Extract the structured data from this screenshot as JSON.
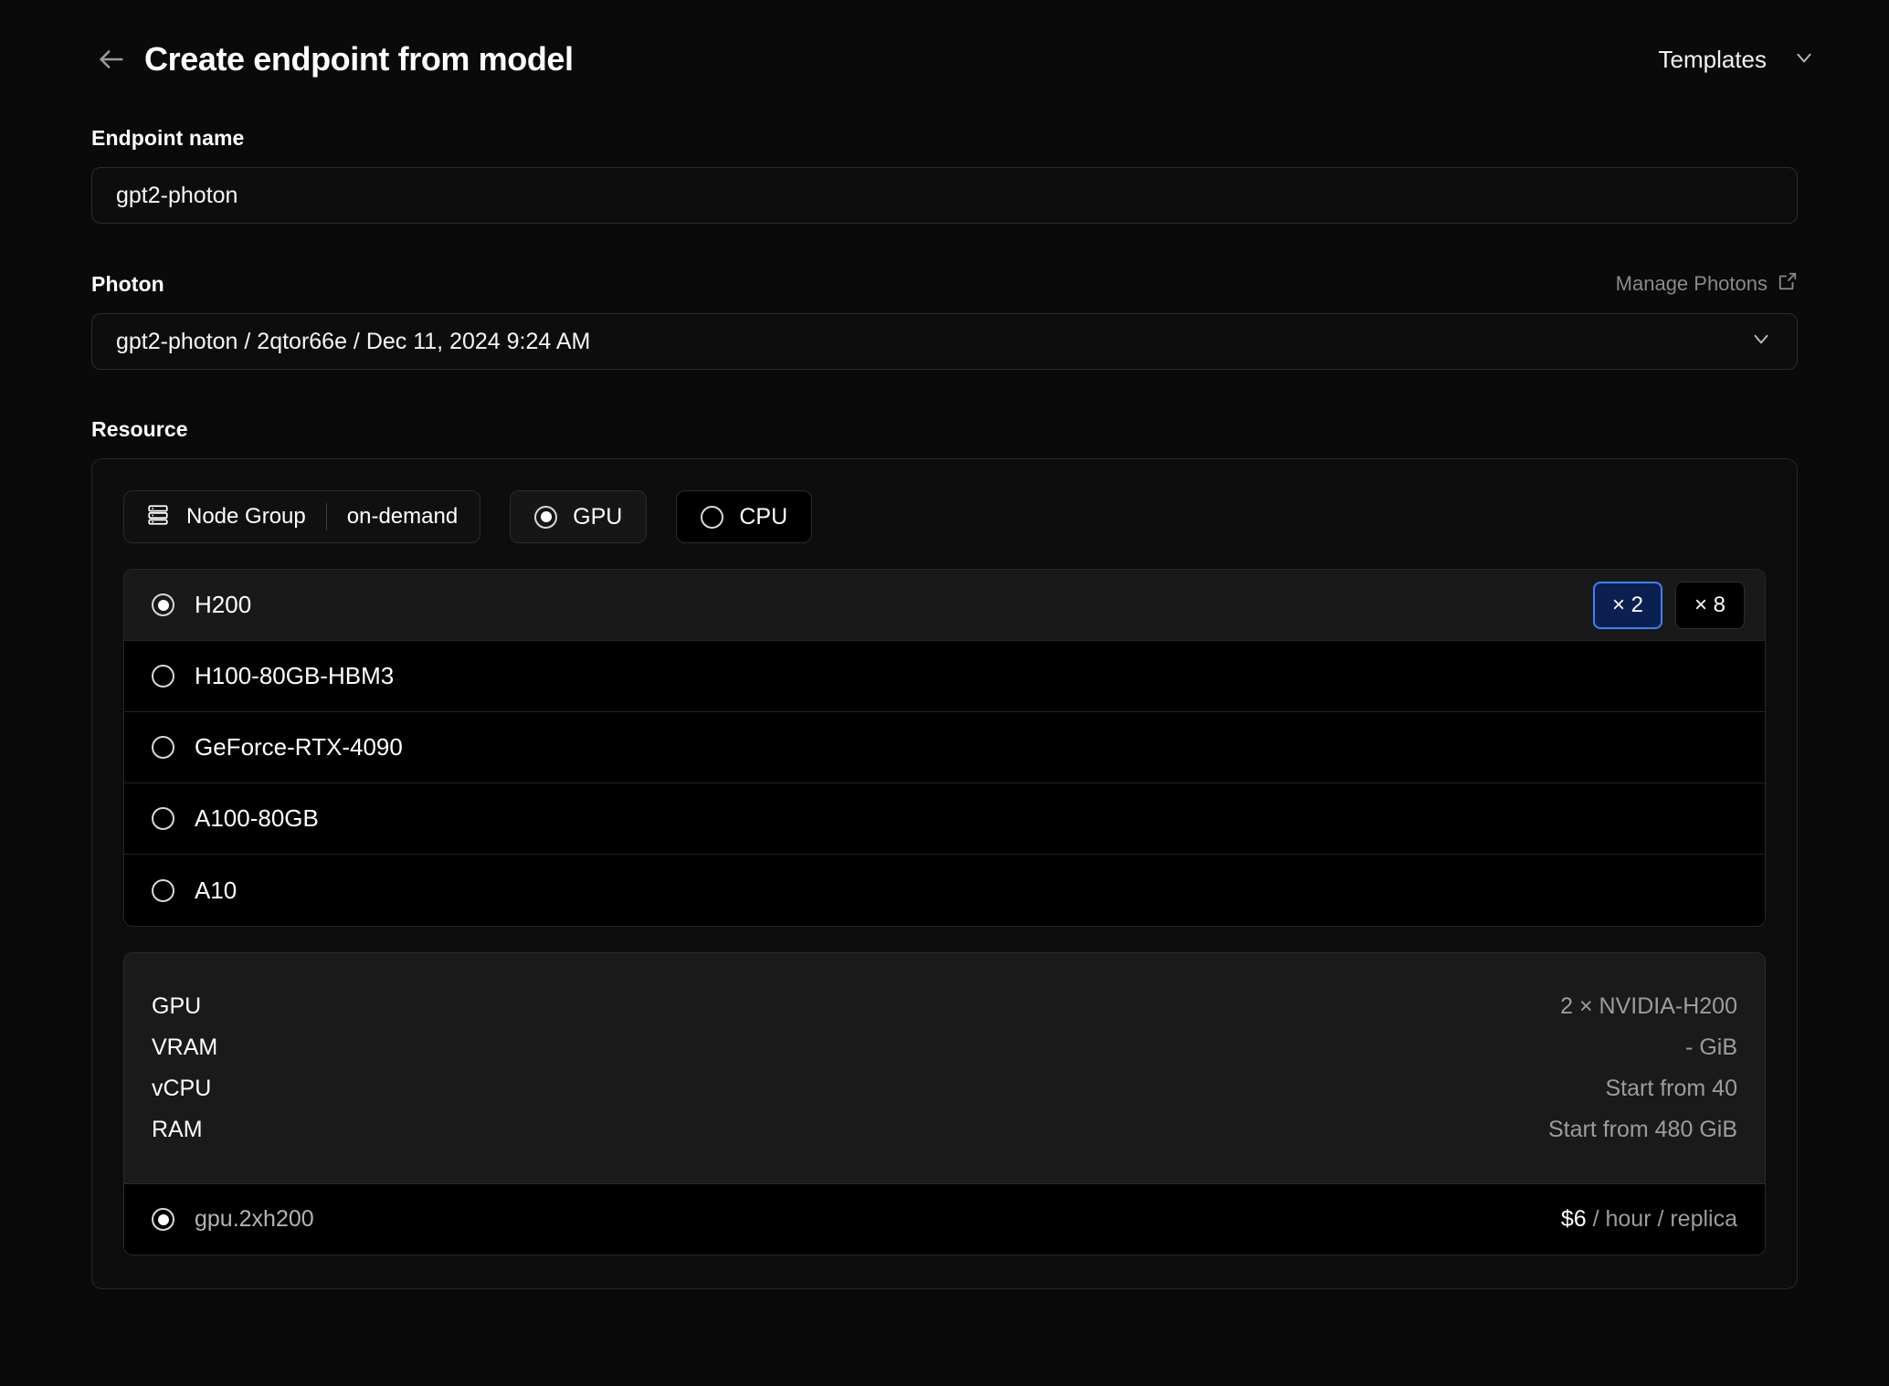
{
  "header": {
    "back_icon": "arrow-left-icon",
    "title": "Create endpoint from model",
    "templates_label": "Templates",
    "templates_chevron": "chevron-down-icon"
  },
  "endpoint_name": {
    "label": "Endpoint name",
    "value": "gpt2-photon",
    "placeholder": "Endpoint name"
  },
  "photon": {
    "label": "Photon",
    "manage_label": "Manage Photons",
    "manage_icon": "external-link-icon",
    "selected": "gpt2-photon / 2qtor66e / Dec 11, 2024 9:24 AM",
    "chevron": "chevron-down-icon"
  },
  "resource": {
    "label": "Resource",
    "node_group": {
      "icon": "server-stack-icon",
      "label": "Node Group",
      "value": "on-demand"
    },
    "compute_types": [
      {
        "label": "GPU",
        "selected": true
      },
      {
        "label": "CPU",
        "selected": false
      }
    ],
    "gpu_options": [
      {
        "label": "H200",
        "selected": true,
        "counts": [
          {
            "label": "× 2",
            "active": true
          },
          {
            "label": "× 8",
            "active": false
          }
        ]
      },
      {
        "label": "H100-80GB-HBM3",
        "selected": false,
        "counts": []
      },
      {
        "label": "GeForce-RTX-4090",
        "selected": false,
        "counts": []
      },
      {
        "label": "A100-80GB",
        "selected": false,
        "counts": []
      },
      {
        "label": "A10",
        "selected": false,
        "counts": []
      }
    ],
    "spec": [
      {
        "key": "GPU",
        "value": "2 × NVIDIA-H200"
      },
      {
        "key": "VRAM",
        "value": "- GiB"
      },
      {
        "key": "vCPU",
        "value": "Start from 40"
      },
      {
        "key": "RAM",
        "value": "Start from 480 GiB"
      }
    ],
    "plan": {
      "name": "gpu.2xh200",
      "selected": true,
      "price_amount": "$6",
      "price_unit": " / hour / replica"
    }
  },
  "colors": {
    "accent_blue": "#3b82f6",
    "accent_blue_fill": "#0b2050",
    "page_bg": "#0a0a0a",
    "muted_text": "#9c9c9c"
  }
}
